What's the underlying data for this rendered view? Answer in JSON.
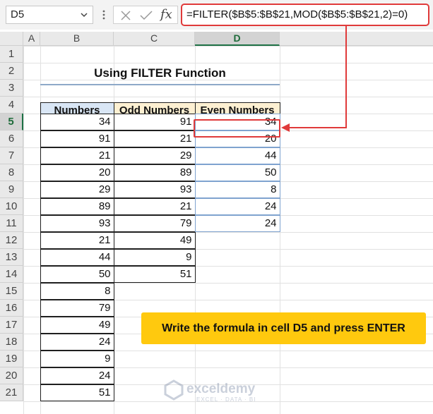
{
  "formula_bar": {
    "name_box": "D5",
    "formula": "=FILTER($B$5:$B$21,MOD($B$5:$B$21,2)=0)",
    "fx_label": "fx"
  },
  "columns": [
    "A",
    "B",
    "C",
    "D"
  ],
  "rows": [
    "1",
    "2",
    "3",
    "4",
    "5",
    "6",
    "7",
    "8",
    "9",
    "10",
    "11",
    "12",
    "13",
    "14",
    "15",
    "16",
    "17",
    "18",
    "19",
    "20",
    "21"
  ],
  "sheet": {
    "title": "Using FILTER Function",
    "headers": {
      "numbers": "Numbers",
      "odd": "Odd Numbers",
      "even": "Even Numbers"
    },
    "numbers": [
      "34",
      "91",
      "21",
      "20",
      "29",
      "89",
      "93",
      "21",
      "44",
      "50",
      "8",
      "79",
      "49",
      "24",
      "9",
      "24",
      "51"
    ],
    "odd": [
      "91",
      "21",
      "29",
      "89",
      "93",
      "21",
      "79",
      "49",
      "9",
      "51"
    ],
    "even": [
      "34",
      "20",
      "44",
      "50",
      "8",
      "24",
      "24"
    ]
  },
  "callout": "Write the formula in cell D5 and press ENTER",
  "watermark": {
    "name": "exceldemy",
    "tagline": "EXCEL · DATA · BI"
  },
  "colors": {
    "accent_red": "#e03a3a",
    "callout_yellow": "#ffc90e",
    "header_blue": "#d9e6f5",
    "header_peach": "#fdf0d2"
  }
}
